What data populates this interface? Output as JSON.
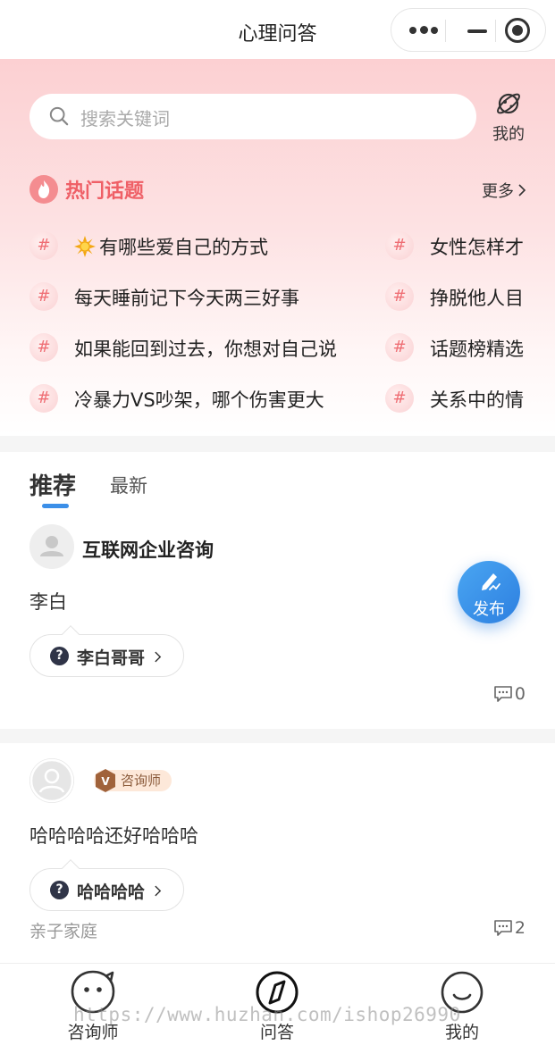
{
  "navbar": {
    "title": "心理问答"
  },
  "search": {
    "placeholder": "搜索关键词"
  },
  "mine_shortcut": {
    "label": "我的"
  },
  "hot_topics": {
    "title": "热门话题",
    "more_label": "更多",
    "hash_symbol": "#",
    "left": [
      "有哪些爱自己的方式",
      "每天睡前记下今天两三好事",
      "如果能回到过去，你想对自己说",
      "冷暴力VS吵架，哪个伤害更大"
    ],
    "right": [
      "女性怎样才",
      "挣脱他人目",
      "话题榜精选",
      "关系中的情"
    ]
  },
  "feed_tabs": {
    "recommend": "推荐",
    "latest": "最新"
  },
  "posts": [
    {
      "author": "互联网企业咨询",
      "content": "李白",
      "question": "李白哥哥",
      "comments": "0"
    },
    {
      "role_badge": "咨询师",
      "content": "哈哈哈哈还好哈哈哈",
      "question": "哈哈哈哈",
      "category": "亲子家庭",
      "comments": "2"
    }
  ],
  "fab": {
    "label": "发布"
  },
  "tabbar": {
    "items": [
      "咨询师",
      "问答",
      "我的"
    ]
  },
  "watermark": "https://www.huzhan.com/ishop26990",
  "colors": {
    "accent_pink": "#ef5f66",
    "accent_blue": "#3b8fe8",
    "badge_bg": "#fde8d9"
  }
}
